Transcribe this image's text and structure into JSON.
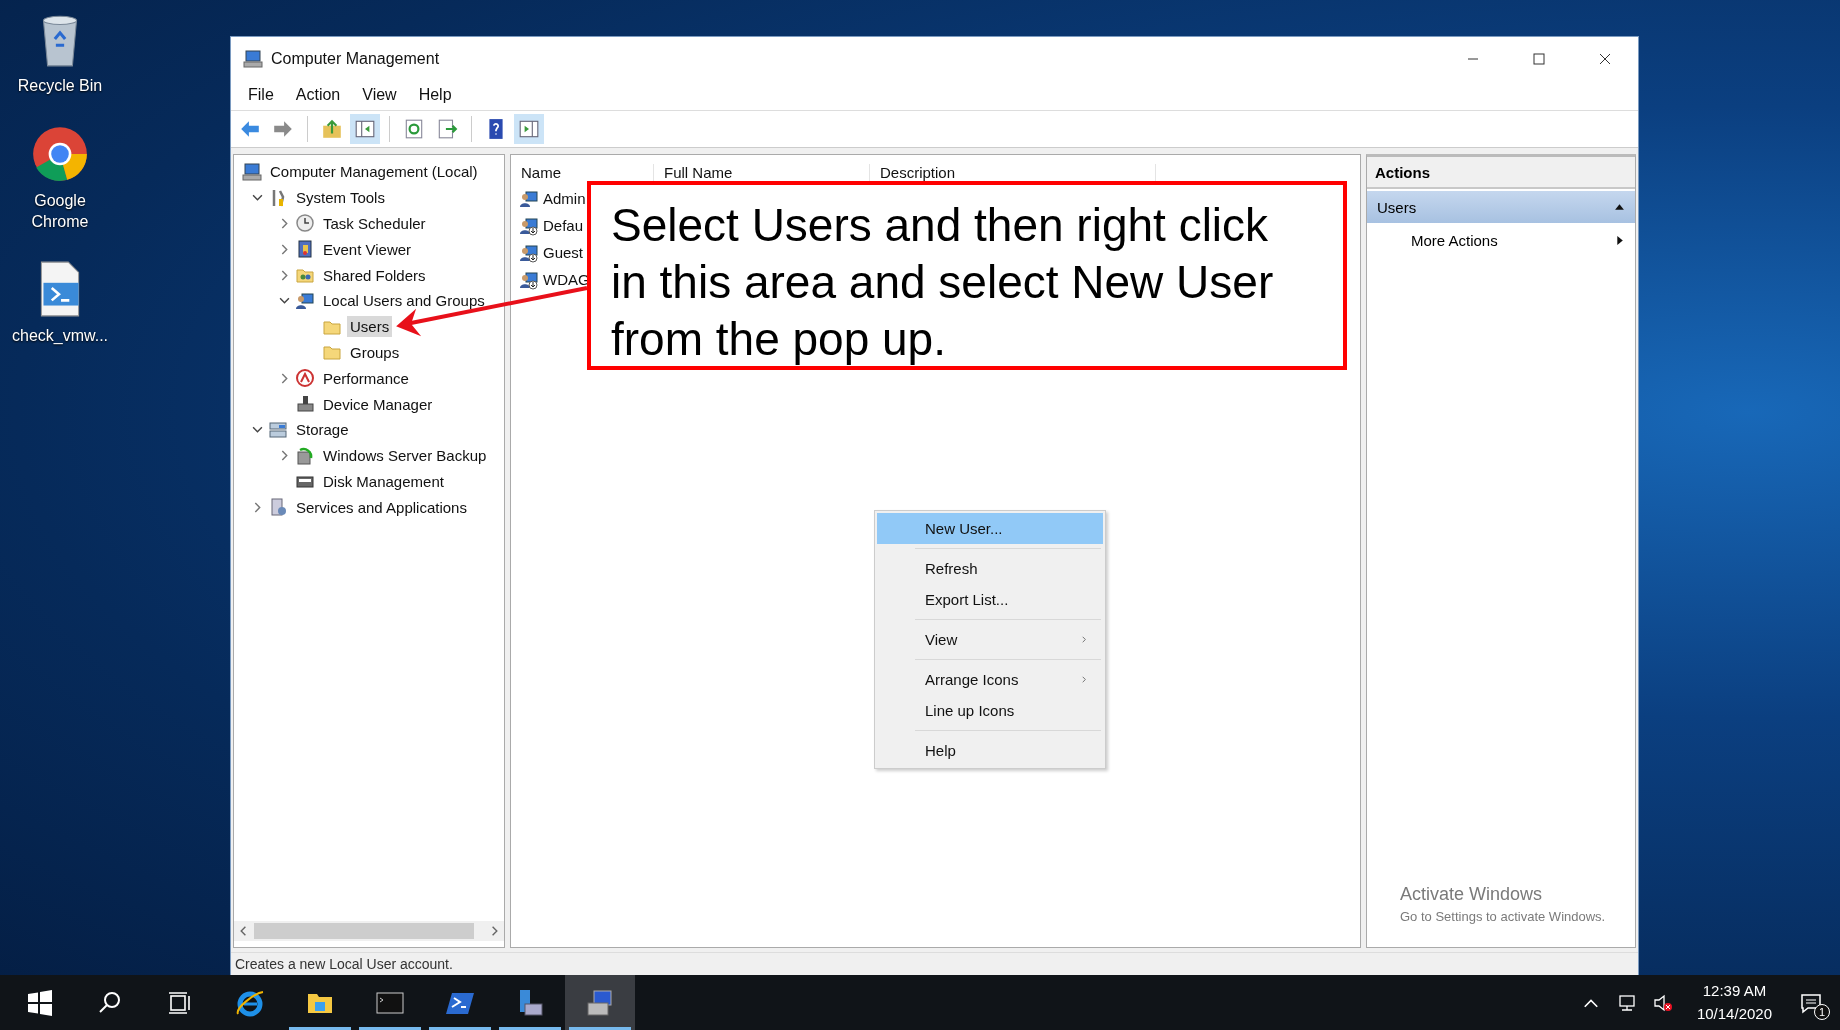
{
  "desktop_icons": [
    {
      "label": "Recycle Bin",
      "kind": "bin"
    },
    {
      "label": "Google Chrome",
      "kind": "browser"
    },
    {
      "label": "check_vmw...",
      "kind": "script"
    }
  ],
  "window": {
    "title": "Computer Management",
    "menu": [
      "File",
      "Action",
      "View",
      "Help"
    ],
    "toolbar": [
      [
        {
          "kind": "back",
          "pressed": false
        },
        {
          "kind": "forward",
          "pressed": false
        }
      ],
      [
        {
          "kind": "up",
          "pressed": false
        },
        {
          "kind": "tree",
          "pressed": true
        }
      ],
      [
        {
          "kind": "refresh",
          "pressed": false
        },
        {
          "kind": "export",
          "pressed": false
        }
      ],
      [
        {
          "kind": "help",
          "pressed": false
        },
        {
          "kind": "pane",
          "pressed": true
        }
      ]
    ],
    "tree": [
      {
        "label": "Computer Management (Local)",
        "kind": "computer",
        "selected": false,
        "children": [
          {
            "label": "System Tools",
            "kind": "tools",
            "expanded": true,
            "selected": false,
            "children": [
              {
                "label": "Task Scheduler",
                "kind": "clock",
                "expanded": false,
                "selected": false
              },
              {
                "label": "Event Viewer",
                "kind": "log",
                "expanded": false,
                "selected": false
              },
              {
                "label": "Shared Folders",
                "kind": "share",
                "expanded": false,
                "selected": false
              },
              {
                "label": "Local Users and Groups",
                "kind": "users",
                "expanded": true,
                "selected": false,
                "children": [
                  {
                    "label": "Users",
                    "kind": "folder",
                    "selected": true
                  },
                  {
                    "label": "Groups",
                    "kind": "folder",
                    "selected": false
                  }
                ]
              },
              {
                "label": "Performance",
                "kind": "perf",
                "expanded": false,
                "selected": false
              },
              {
                "label": "Device Manager",
                "kind": "device",
                "selected": false
              }
            ]
          },
          {
            "label": "Storage",
            "kind": "storage",
            "expanded": true,
            "selected": false,
            "children": [
              {
                "label": "Windows Server Backup",
                "kind": "backup",
                "expanded": false,
                "selected": false
              },
              {
                "label": "Disk Management",
                "kind": "disk",
                "selected": false
              }
            ]
          },
          {
            "label": "Services and Applications",
            "kind": "services",
            "expanded": false,
            "selected": false
          }
        ]
      }
    ],
    "list": {
      "columns": [
        "Name",
        "Full Name",
        "Description"
      ],
      "rows": [
        {
          "name": "Admin",
          "kind": "admin"
        },
        {
          "name": "Defau",
          "kind": "disabled"
        },
        {
          "name": "Guest",
          "kind": "disabled"
        },
        {
          "name": "WDAG",
          "kind": "disabled"
        }
      ]
    },
    "actions": {
      "title": "Actions",
      "section": {
        "label": "Users",
        "expanded": true
      },
      "items": [
        "More Actions"
      ]
    },
    "status_bar": "Creates a new Local User account."
  },
  "context_menu": [
    [
      {
        "label": "New User...",
        "selected": true,
        "submenu": false
      }
    ],
    [
      {
        "label": "Refresh",
        "selected": false,
        "submenu": false
      },
      {
        "label": "Export List...",
        "selected": false,
        "submenu": false
      }
    ],
    [
      {
        "label": "View",
        "selected": false,
        "submenu": true
      }
    ],
    [
      {
        "label": "Arrange Icons",
        "selected": false,
        "submenu": true
      },
      {
        "label": "Line up Icons",
        "selected": false,
        "submenu": false
      }
    ],
    [
      {
        "label": "Help",
        "selected": false,
        "submenu": false
      }
    ]
  ],
  "callout": {
    "text": "Select Users and then right click\nin this area and select New User\nfrom the pop up."
  },
  "activation": {
    "title": "Activate Windows",
    "subtitle": "Go to Settings to activate Windows."
  },
  "taskbar": {
    "items": [
      {
        "kind": "start",
        "running": false,
        "active": false
      },
      {
        "kind": "search",
        "running": false,
        "active": false
      },
      {
        "kind": "taskview",
        "running": false,
        "active": false
      },
      {
        "kind": "ie",
        "running": false,
        "active": false
      },
      {
        "kind": "explorer",
        "running": true,
        "active": false
      },
      {
        "kind": "cmd",
        "running": true,
        "active": false
      },
      {
        "kind": "powershell",
        "running": true,
        "active": false
      },
      {
        "kind": "server",
        "running": true,
        "active": false
      },
      {
        "kind": "compmgmt",
        "running": true,
        "active": true
      }
    ],
    "time": "12:39 AM",
    "date": "10/14/2020",
    "notifications": "1"
  }
}
